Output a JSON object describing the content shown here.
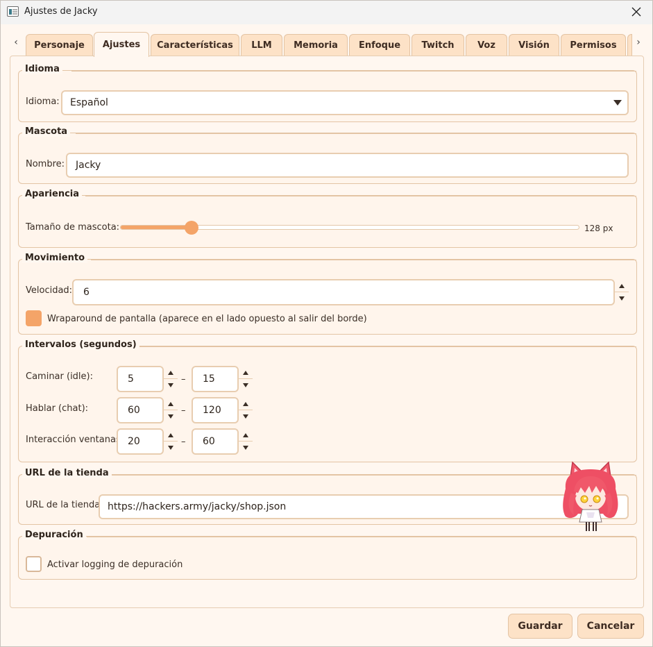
{
  "window": {
    "title": "Ajustes de Jacky"
  },
  "tabs": [
    {
      "label": "Personaje"
    },
    {
      "label": "Ajustes"
    },
    {
      "label": "Características"
    },
    {
      "label": "LLM"
    },
    {
      "label": "Memoria"
    },
    {
      "label": "Enfoque"
    },
    {
      "label": "Twitch"
    },
    {
      "label": "Voz"
    },
    {
      "label": "Visión"
    },
    {
      "label": "Permisos"
    }
  ],
  "active_tab": "Ajustes",
  "idioma": {
    "group_title": "Idioma",
    "label": "Idioma:",
    "value": "Español"
  },
  "mascota": {
    "group_title": "Mascota",
    "label": "Nombre:",
    "value": "Jacky"
  },
  "apariencia": {
    "group_title": "Apariencia",
    "label": "Tamaño de mascota:",
    "value_text": "128 px",
    "slider_fraction": 0.155
  },
  "movimiento": {
    "group_title": "Movimiento",
    "velocidad_label": "Velocidad:",
    "velocidad_value": "6",
    "wrap_label": "Wraparound de pantalla (aparece en el lado opuesto al salir del borde)",
    "wrap_checked": true
  },
  "intervalos": {
    "group_title": "Intervalos (segundos)",
    "separator": "–",
    "rows": [
      {
        "label": "Caminar (idle):",
        "min": "5",
        "max": "15"
      },
      {
        "label": "Hablar (chat):",
        "min": "60",
        "max": "120"
      },
      {
        "label": "Interacción ventanas:",
        "min": "20",
        "max": "60"
      }
    ]
  },
  "tienda": {
    "group_title": "URL de la tienda",
    "label": "URL de la tienda:",
    "value": "https://hackers.army/jacky/shop.json"
  },
  "depuracion": {
    "group_title": "Depuración",
    "label": "Activar logging de depuración",
    "checked": false
  },
  "buttons": {
    "save": "Guardar",
    "cancel": "Cancelar"
  },
  "colors": {
    "accent": "#f4a468",
    "tab_bg": "#fde2c7",
    "panel_bg": "#fff7f0",
    "border": "#e3c4a4"
  },
  "icons": {
    "close": "close-icon",
    "app": "app-icon",
    "tab_left": "chevron-left-icon",
    "tab_right": "chevron-right-icon",
    "dropdown": "chevron-down-icon"
  }
}
